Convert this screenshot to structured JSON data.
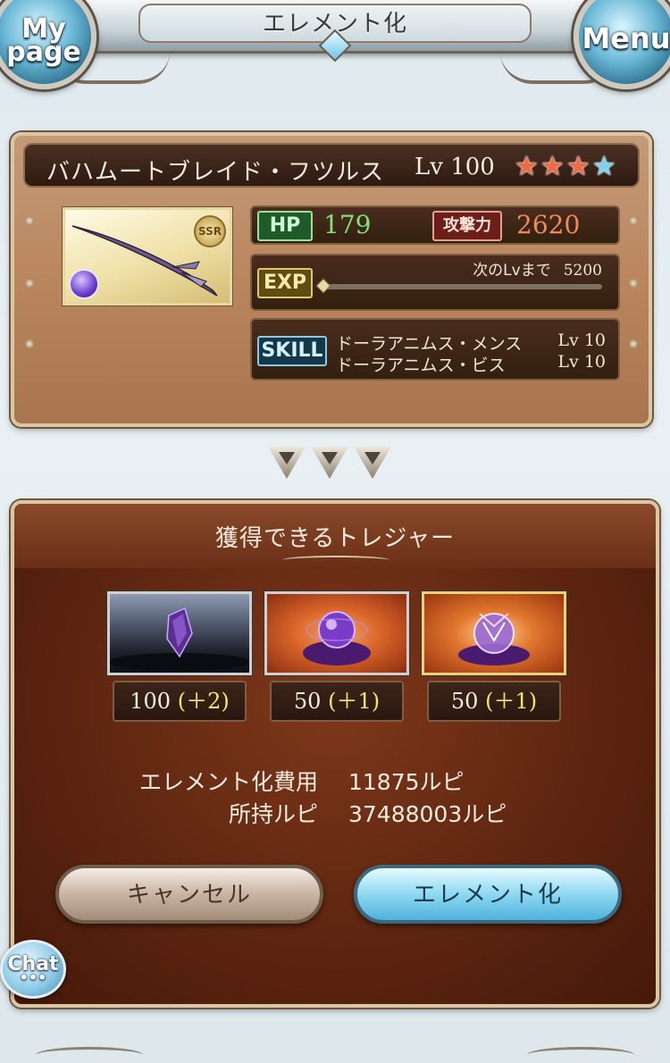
{
  "header": {
    "title": "エレメント化",
    "mypage_line1": "My",
    "mypage_line2": "page",
    "menu_label": "Menu"
  },
  "weapon": {
    "name": "バハムートブレイド・フツルス",
    "level": "Lv 100",
    "rarity_badge": "SSR",
    "stars": {
      "red": 3,
      "blue": 1
    },
    "hp_label": "HP",
    "hp": "179",
    "atk_label": "攻撃力",
    "atk": "2620",
    "exp_label": "EXP",
    "exp_next_label": "次のLvまで",
    "exp_next_value": "5200",
    "exp_fill": 0,
    "skill_label": "SKILL",
    "skills": [
      {
        "name": "ドーラアニムス・メンス",
        "level": "Lv 10"
      },
      {
        "name": "ドーラアニムス・ビス",
        "level": "Lv 10"
      }
    ]
  },
  "treasure": {
    "title": "獲得できるトレジャー",
    "items": [
      {
        "icon": "dark-crystal-icon",
        "count": "100",
        "bonus": "(＋2)"
      },
      {
        "icon": "purple-orb-icon",
        "count": "50",
        "bonus": "(＋1)"
      },
      {
        "icon": "dark-anima-icon",
        "count": "50",
        "bonus": "(＋1)"
      }
    ]
  },
  "cost": {
    "fee_label": "エレメント化費用",
    "fee_value": "11875ルピ",
    "owned_label": "所持ルピ",
    "owned_value": "37488003ルピ"
  },
  "buttons": {
    "cancel": "キャンセル",
    "confirm": "エレメント化"
  },
  "chat": {
    "label": "Chat",
    "dots": "•••"
  },
  "colors": {
    "panel_brown": "#b9865e",
    "treasure_bg": "#5b2410",
    "hp_green": "#7fe07a",
    "atk_orange": "#f08a5c",
    "bonus_yellow": "#f2e86a",
    "confirm_blue": "#8ed8f1"
  }
}
